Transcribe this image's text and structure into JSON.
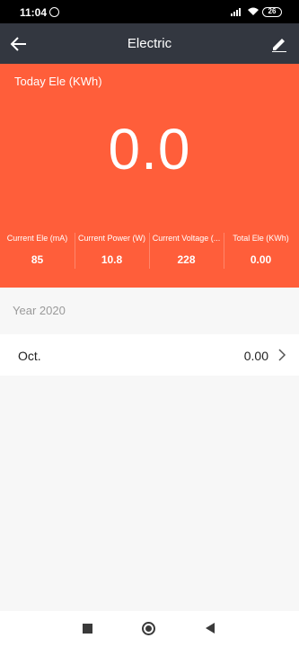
{
  "status_bar": {
    "time": "11:04",
    "battery": "26"
  },
  "app_bar": {
    "title": "Electric"
  },
  "hero": {
    "label": "Today Ele (KWh)",
    "value": "0.0",
    "stats": [
      {
        "name": "Current Ele (mA)",
        "value": "85"
      },
      {
        "name": "Current Power (W)",
        "value": "10.8"
      },
      {
        "name": "Current Voltage (...",
        "value": "228"
      },
      {
        "name": "Total Ele (KWh)",
        "value": "0.00"
      }
    ]
  },
  "history": {
    "year": "Year 2020",
    "rows": [
      {
        "month": "Oct.",
        "amount": "0.00"
      }
    ]
  },
  "colors": {
    "accent": "#ff5e3a",
    "app_bar": "#333740",
    "background": "#f7f7f7"
  },
  "icons": [
    "alarm-icon",
    "signal-icon",
    "wifi-icon",
    "battery-icon",
    "back-arrow-icon",
    "edit-pencil-icon",
    "chevron-right-icon",
    "recents-icon",
    "home-icon",
    "back-icon"
  ]
}
